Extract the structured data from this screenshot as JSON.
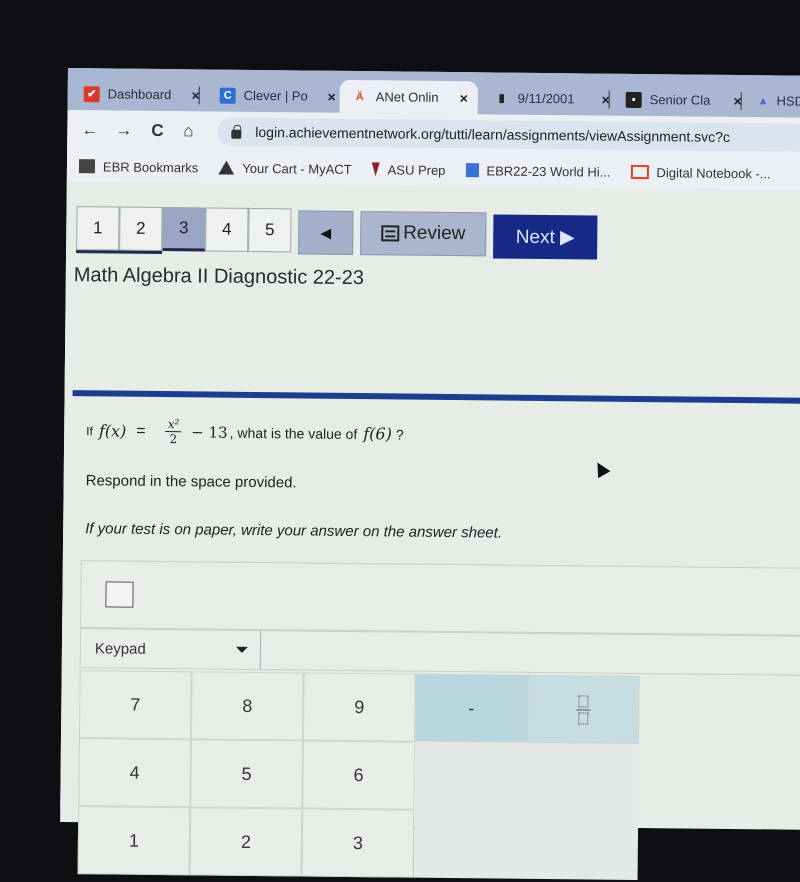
{
  "browser": {
    "tabs": [
      {
        "title": "Dashboard",
        "icon": "canvas-icon",
        "color": "#d93b2b",
        "glyph": "✔"
      },
      {
        "title": "Clever | Po",
        "icon": "clever-icon",
        "color": "#2d6fd6",
        "glyph": "C"
      },
      {
        "title": "ANet Onlin",
        "icon": "anet-icon",
        "color": "#e04b2b",
        "glyph": "Ä",
        "active": true
      },
      {
        "title": "9/11/2001",
        "icon": "book-icon",
        "color": "#222222",
        "glyph": "▮"
      },
      {
        "title": "Senior Cla",
        "icon": "classroom-icon",
        "color": "#222222",
        "glyph": "▪"
      },
      {
        "title": "HSD",
        "icon": "drive-icon",
        "color": "#3b6fd9",
        "glyph": "▲"
      }
    ],
    "close_glyph": "×",
    "nav": {
      "back": "←",
      "forward": "→",
      "reload": "C",
      "home": "⌂"
    },
    "url": "login.achievementnetwork.org/tutti/learn/assignments/viewAssignment.svc?c",
    "bookmarks": [
      {
        "label": "EBR Bookmarks",
        "icon": "folder-icon",
        "color": "#444444"
      },
      {
        "label": "Your Cart - MyACT",
        "icon": "act-icon",
        "color": "#333333"
      },
      {
        "label": "ASU Prep",
        "icon": "asu-icon",
        "color": "#8a1f2a"
      },
      {
        "label": "EBR22-23 World Hi...",
        "icon": "docs-icon",
        "color": "#3b6fd9"
      },
      {
        "label": "Digital Notebook -...",
        "icon": "slides-icon",
        "color": "#d9472b"
      }
    ]
  },
  "assessment": {
    "question_numbers": [
      "1",
      "2",
      "3",
      "4",
      "5"
    ],
    "current_question": "3",
    "prev_glyph": "◀",
    "review_label": "Review",
    "next_label": "Next ▶",
    "title": "Math Algebra II Diagnostic 22-23",
    "question": {
      "prefix": "If",
      "func": "f(x)",
      "equals": "=",
      "numerator": "x²",
      "denominator": "2",
      "rest": "− 13",
      "suffix": ", what is the value of",
      "target": "f(6)",
      "end": "?"
    },
    "instruction": "Respond in the space provided.",
    "paper_instruction": "If your test is on paper, write your answer on the answer sheet.",
    "answer_value": "",
    "keypad": {
      "label": "Keypad",
      "keys": [
        "7",
        "8",
        "9",
        "-",
        "fraction",
        "4",
        "5",
        "6",
        "",
        "",
        "1",
        "2",
        "3",
        "",
        ""
      ]
    }
  }
}
